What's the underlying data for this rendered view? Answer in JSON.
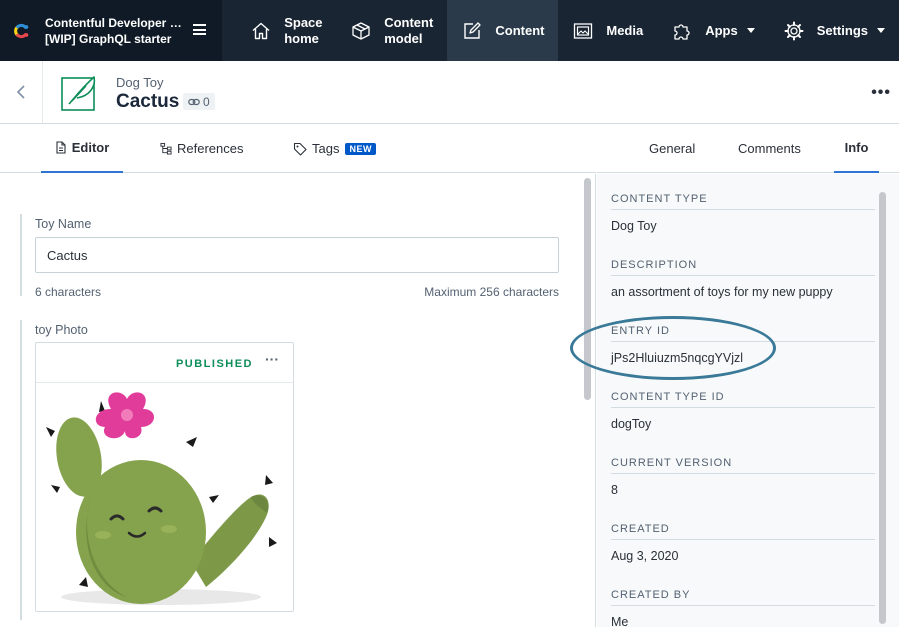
{
  "space": {
    "org": "Contentful Developer Rel...",
    "name": "[WIP] GraphQL starter"
  },
  "nav": {
    "space_home": [
      "Space",
      "home"
    ],
    "content_model": [
      "Content",
      "model"
    ],
    "content": "Content",
    "media": "Media",
    "apps": "Apps",
    "settings": "Settings"
  },
  "entry": {
    "content_type": "Dog Toy",
    "title": "Cactus",
    "link_count": "0"
  },
  "editor_tabs": {
    "editor": "Editor",
    "references": "References",
    "tags": "Tags",
    "tags_badge": "NEW"
  },
  "fields": {
    "toy_name": {
      "label": "Toy Name",
      "value": "Cactus",
      "count": "6 characters",
      "max": "Maximum 256 characters"
    },
    "toy_photo": {
      "label": "toy Photo",
      "status": "PUBLISHED"
    }
  },
  "side_tabs": {
    "general": "General",
    "comments": "Comments",
    "info": "Info"
  },
  "info": [
    {
      "label": "CONTENT TYPE",
      "value": "Dog Toy"
    },
    {
      "label": "DESCRIPTION",
      "value": "an assortment of toys for my new puppy"
    },
    {
      "label": "ENTRY ID",
      "value": "jPs2Hluiuzm5nqcgYVjzl"
    },
    {
      "label": "CONTENT TYPE ID",
      "value": "dogToy"
    },
    {
      "label": "CURRENT VERSION",
      "value": "8"
    },
    {
      "label": "CREATED",
      "value": "Aug 3, 2020"
    },
    {
      "label": "CREATED BY",
      "value": "Me"
    }
  ],
  "colors": {
    "nav_bg": "#192532",
    "accent": "#2e75d4",
    "published": "#0d8d58",
    "highlight": "#3a7a98"
  }
}
